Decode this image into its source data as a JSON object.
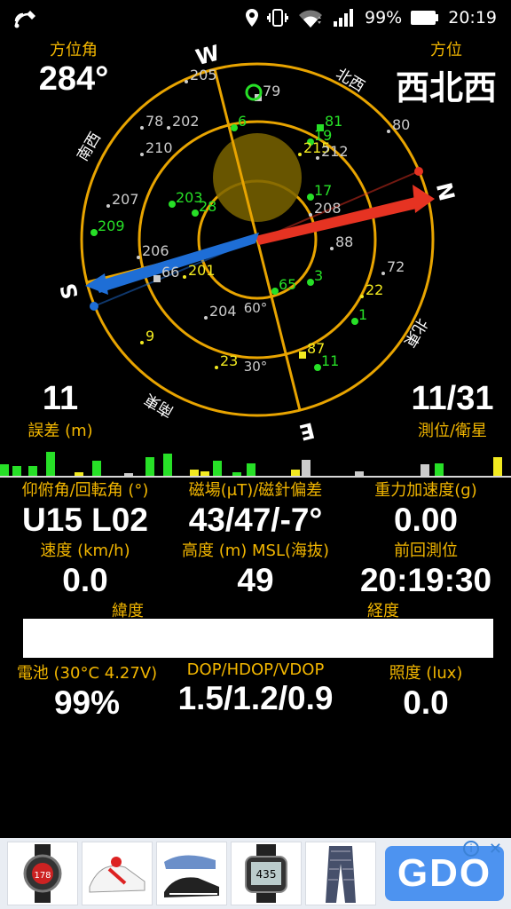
{
  "status": {
    "battery_text": "99%",
    "time": "20:19",
    "icons": [
      "notification-wave-icon",
      "location-icon",
      "vibrate-icon",
      "wifi-icon",
      "signal-icon",
      "battery-icon"
    ]
  },
  "header": {
    "azimuth_label": "方位角",
    "azimuth_value": "284°",
    "direction_label": "方位",
    "direction_value": "西北西",
    "error_value": "11",
    "error_label": "誤差 (m)",
    "sats_value": "11/31",
    "sats_label": "測位/衛星"
  },
  "compass": {
    "cardinals": {
      "n": "N",
      "s": "S",
      "e": "E",
      "w": "W"
    },
    "intercardinals": {
      "nw": "北西",
      "ne": "北東",
      "sw": "南西",
      "se": "南東"
    },
    "ring_labels": {
      "r60": "60°",
      "r30": "30°"
    },
    "ring_color": "#e8a400",
    "arrow_red": "#e63322",
    "arrow_blue": "#1e6ed6",
    "satellites": [
      {
        "id": "205",
        "color": "#cccccc",
        "shape": "dot"
      },
      {
        "id": "79",
        "color": "#cccccc",
        "shape": "square"
      },
      {
        "id": "202",
        "color": "#cccccc",
        "shape": "dot"
      },
      {
        "id": "78",
        "color": "#cccccc",
        "shape": "dot"
      },
      {
        "id": "6",
        "color": "#27e027",
        "shape": "dot"
      },
      {
        "id": "81",
        "color": "#27e027",
        "shape": "square"
      },
      {
        "id": "19",
        "color": "#27e027",
        "shape": "dot"
      },
      {
        "id": "80",
        "color": "#cccccc",
        "shape": "dot"
      },
      {
        "id": "210",
        "color": "#cccccc",
        "shape": "dot"
      },
      {
        "id": "215",
        "color": "#f2ea20",
        "shape": "dot"
      },
      {
        "id": "212",
        "color": "#cccccc",
        "shape": "dot"
      },
      {
        "id": "207",
        "color": "#cccccc",
        "shape": "dot"
      },
      {
        "id": "203",
        "color": "#27e027",
        "shape": "dot"
      },
      {
        "id": "28",
        "color": "#27e027",
        "shape": "dot"
      },
      {
        "id": "17",
        "color": "#27e027",
        "shape": "dot"
      },
      {
        "id": "208",
        "color": "#cccccc",
        "shape": "dot"
      },
      {
        "id": "209",
        "color": "#27e027",
        "shape": "dot"
      },
      {
        "id": "88",
        "color": "#cccccc",
        "shape": "dot"
      },
      {
        "id": "206",
        "color": "#cccccc",
        "shape": "dot"
      },
      {
        "id": "66",
        "color": "#cccccc",
        "shape": "square"
      },
      {
        "id": "201",
        "color": "#f2ea20",
        "shape": "dot"
      },
      {
        "id": "72",
        "color": "#cccccc",
        "shape": "dot"
      },
      {
        "id": "65",
        "color": "#27e027",
        "shape": "dot"
      },
      {
        "id": "3",
        "color": "#27e027",
        "shape": "dot"
      },
      {
        "id": "22",
        "color": "#f2ea20",
        "shape": "dot"
      },
      {
        "id": "204",
        "color": "#cccccc",
        "shape": "dot"
      },
      {
        "id": "1",
        "color": "#27e027",
        "shape": "dot"
      },
      {
        "id": "9",
        "color": "#f2ea20",
        "shape": "dot"
      },
      {
        "id": "87",
        "color": "#f2ea20",
        "shape": "square"
      },
      {
        "id": "23",
        "color": "#f2ea20",
        "shape": "dot"
      },
      {
        "id": "11",
        "color": "#27e027",
        "shape": "dot"
      }
    ]
  },
  "signal_bars": [
    {
      "h": 0.35,
      "c": "#27e027"
    },
    {
      "h": 0.28,
      "c": "#27e027"
    },
    {
      "h": 0.3,
      "c": "#27e027"
    },
    {
      "h": 0.72,
      "c": "#27e027"
    },
    {
      "h": 0.1,
      "c": "#f2ea20"
    },
    {
      "h": 0.45,
      "c": "#27e027"
    },
    {
      "h": 0.08,
      "c": "#cccccc"
    },
    {
      "h": 0.55,
      "c": "#27e027"
    },
    {
      "h": 0.65,
      "c": "#27e027"
    },
    {
      "h": 0.18,
      "c": "#f2ea20"
    },
    {
      "h": 0.12,
      "c": "#f2ea20"
    },
    {
      "h": 0.45,
      "c": "#27e027"
    },
    {
      "h": 0.1,
      "c": "#27e027"
    },
    {
      "h": 0.38,
      "c": "#27e027"
    },
    {
      "h": 0.48,
      "c": "#cccccc"
    },
    {
      "h": 0.18,
      "c": "#f2ea20"
    },
    {
      "h": 0.12,
      "c": "#cccccc"
    },
    {
      "h": 0.35,
      "c": "#cccccc"
    },
    {
      "h": 0.38,
      "c": "#27e027"
    },
    {
      "h": 0.55,
      "c": "#f2ea20"
    }
  ],
  "readouts": {
    "tilt_label": "仰俯角/回転角 (°)",
    "tilt_value": "U15 L02",
    "mag_label": "磁場(μT)/磁針偏差",
    "mag_value": "43/47/-7°",
    "grav_label": "重力加速度(g)",
    "grav_value": "0.00",
    "speed_label": "速度 (km/h)",
    "speed_value": "0.0",
    "alt_label": "高度 (m) MSL(海抜)",
    "alt_value": "49",
    "last_label": "前回測位",
    "last_value": "20:19:30",
    "lat_label": "緯度",
    "lon_label": "経度",
    "battery_label": "電池 (30°C 4.27V)",
    "battery_value": "99%",
    "dop_label": "DOP/HDOP/VDOP",
    "dop_value": "1.5/1.2/0.9",
    "lux_label": "照度 (lux)",
    "lux_value": "0.0"
  },
  "ad": {
    "logo": "GDO",
    "info": "i",
    "close": "✕",
    "products": [
      "golf-gps-watch",
      "golf-shoe-white",
      "golf-shoe-black",
      "golf-gps-watch-2",
      "golf-pants"
    ]
  }
}
